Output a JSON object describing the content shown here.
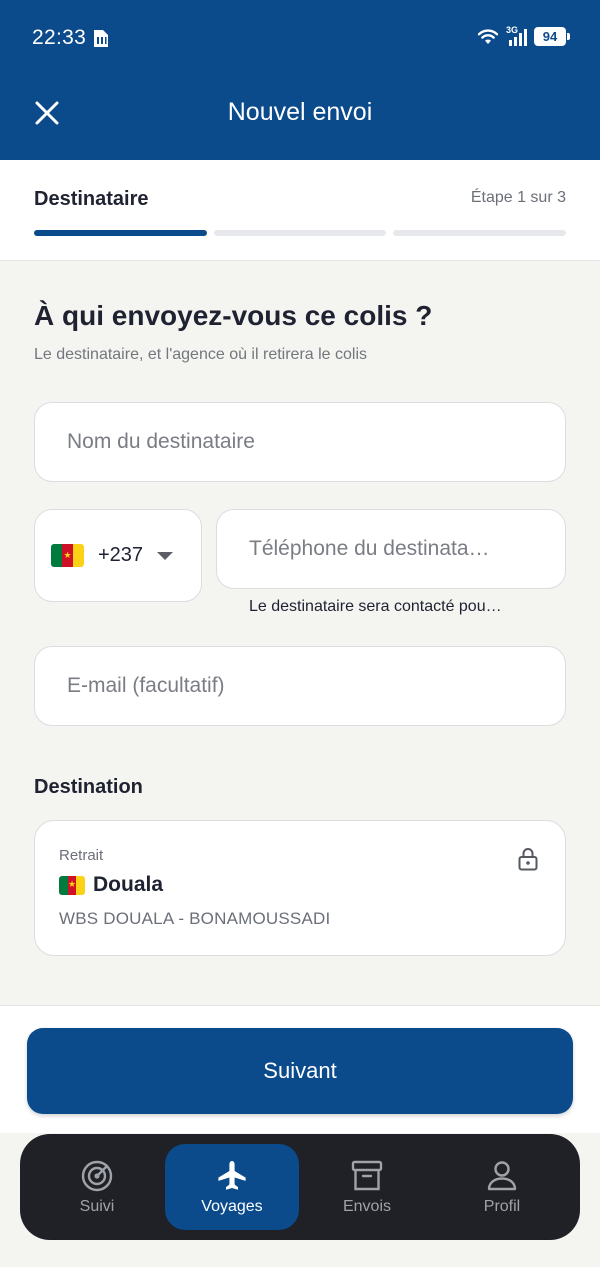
{
  "status_bar": {
    "time": "22:33",
    "network": "3G",
    "battery": "94"
  },
  "app_bar": {
    "title": "Nouvel envoi",
    "close_icon": "close-icon"
  },
  "stepper": {
    "title": "Destinataire",
    "count": "Étape 1 sur 3",
    "total_steps": 3,
    "current_step": 1
  },
  "form": {
    "heading": "À qui envoyez-vous ce colis ?",
    "subheading": "Le destinataire, et l'agence où il retirera le colis",
    "name_placeholder": "Nom du destinataire",
    "country_flag": "cameroon-flag",
    "dial_code": "+237",
    "phone_placeholder": "Téléphone du destinata…",
    "phone_help": "Le destinataire sera contacté pou…",
    "email_placeholder": "E-mail (facultatif)"
  },
  "destination": {
    "section_title": "Destination",
    "kind": "Retrait",
    "city": "Douala",
    "agency": "WBS DOUALA - BONAMOUSSADI",
    "lock_icon": "lock-icon"
  },
  "footer": {
    "next_label": "Suivant"
  },
  "tabs": [
    {
      "label": "Suivi",
      "icon": "radar-icon",
      "active": false
    },
    {
      "label": "Voyages",
      "icon": "airplane-icon",
      "active": true
    },
    {
      "label": "Envois",
      "icon": "archive-box-icon",
      "active": false
    },
    {
      "label": "Profil",
      "icon": "person-icon",
      "active": false
    }
  ],
  "colors": {
    "primary": "#0b4a8b",
    "background": "#f4f4f1",
    "tabbar": "#1f2127"
  }
}
